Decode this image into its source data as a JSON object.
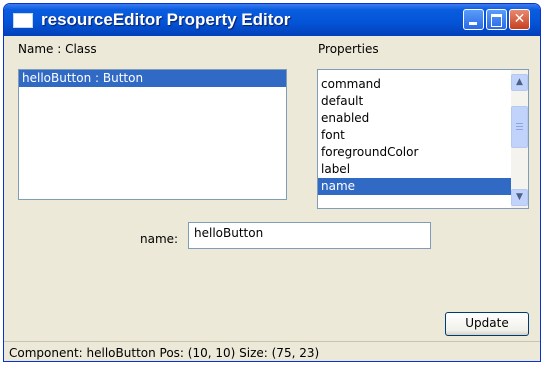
{
  "window": {
    "title": "resourceEditor Property Editor"
  },
  "components_panel": {
    "header": "Name : Class",
    "items": [
      {
        "label": "helloButton : Button",
        "selected": true
      }
    ]
  },
  "properties_panel": {
    "header": "Properties",
    "items": [
      {
        "label": "command",
        "selected": false
      },
      {
        "label": "default",
        "selected": false
      },
      {
        "label": "enabled",
        "selected": false
      },
      {
        "label": "font",
        "selected": false
      },
      {
        "label": "foregroundColor",
        "selected": false
      },
      {
        "label": "label",
        "selected": false
      },
      {
        "label": "name",
        "selected": true
      }
    ]
  },
  "editor": {
    "field_label": "name:",
    "field_value": "helloButton"
  },
  "update_button": {
    "label": "Update"
  },
  "status_bar": {
    "text": "Component: helloButton  Pos: (10, 10)  Size: (75, 23)"
  },
  "icons": {
    "minimize": "minimize-icon",
    "maximize": "maximize-icon",
    "close": "close-icon",
    "scroll_up": "chevron-up-icon",
    "scroll_down": "chevron-down-icon"
  },
  "colors": {
    "title_bar": "#0453d6",
    "selection": "#316ac5",
    "window_bg": "#ece9d8"
  }
}
